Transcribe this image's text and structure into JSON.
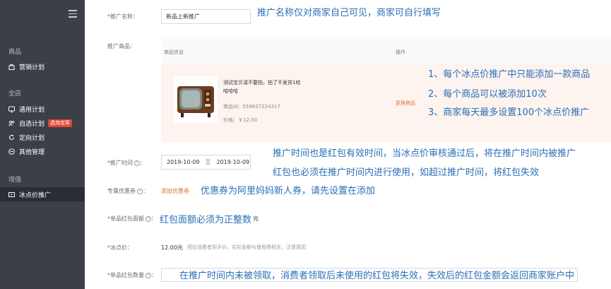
{
  "sidebar": {
    "sections": [
      {
        "title": "商品",
        "items": [
          {
            "label": "营销计划",
            "icon": "bag-icon"
          }
        ]
      },
      {
        "title": "全店",
        "items": [
          {
            "label": "通用计划",
            "icon": "tv-icon"
          },
          {
            "label": "自选计划",
            "icon": "people-icon",
            "badge": "选淘宝客"
          },
          {
            "label": "定向计划",
            "icon": "refresh-icon"
          },
          {
            "label": "其他管理",
            "icon": "minus-circle-icon"
          }
        ]
      },
      {
        "title": "增值",
        "items": [
          {
            "label": "冰点价推广",
            "icon": "ticket-icon",
            "active": true
          }
        ]
      }
    ]
  },
  "form": {
    "name_label": "*推广名称：",
    "name_value": "新品上新推广",
    "product_label": "推广商品：",
    "table_header_info": "商品信息",
    "table_header_action": "操作",
    "product_title_line1": "测试宝贝请不要拍，拍了不发货1哈",
    "product_title_line2": "哈哈哈",
    "product_id": "商品Id：559637224317",
    "product_price": "价格：￥12.00",
    "change_product": "更换商品",
    "time_label": "*推广时间",
    "date_start": "2019-10-09",
    "date_sep": "至",
    "date_end": "2019-10-09",
    "coupon_label": "专属优惠券",
    "coupon_add": "添加优惠券",
    "red_amount_label": "*单品红包面额",
    "red_amount_unit": "元",
    "freeze_label": "*冰点价：",
    "freeze_value": "12.00元",
    "freeze_hint": "预估消费者到手价，实际金额与使用券相关，注意原因",
    "red_count_label": "*单品红包数量"
  },
  "notes": {
    "n1": "推广名称仅对商家自己可见，商家可自行填写",
    "n2": "1、每个冰点价推广中只能添加一款商品",
    "n3": "2、每个商品可以被添加10次",
    "n4": "3、商家每天最多设置100个冰点价推广",
    "n5": "推广时间也是红包有效时间，当冰点价审核通过后，将在推广时间内被推广",
    "n6": "红包也必须在推广时间内进行使用，如超过推广时间，将红包失效",
    "n7": "优惠券为阿里妈妈新人券，请先设置在添加",
    "n8": "红包面额必须为正整数",
    "n9": "在推广时间内未被领取，消费者领取后未使用的红包将失效，失效后的红包金额会返回商家账户中"
  }
}
